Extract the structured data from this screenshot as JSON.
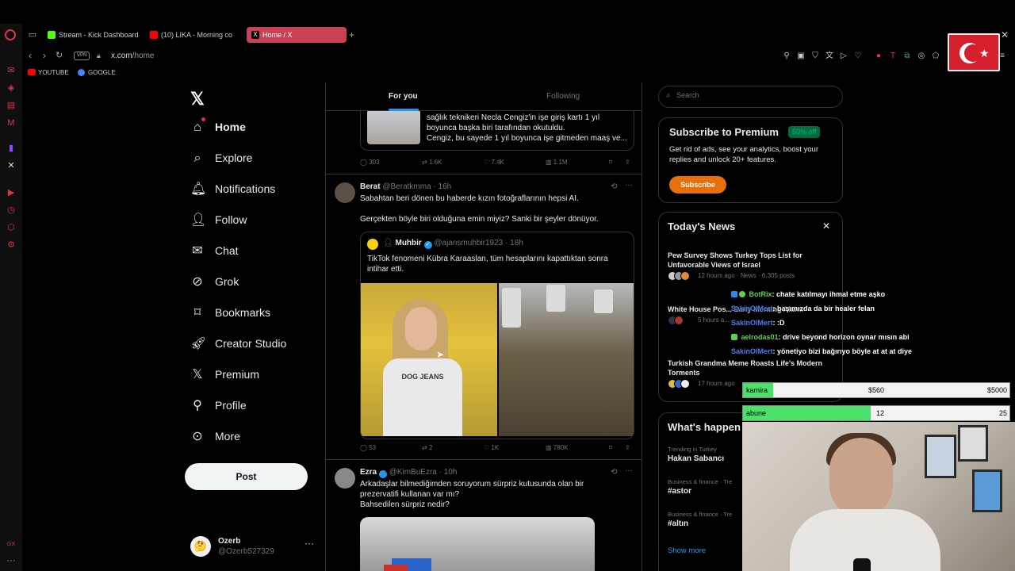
{
  "browser": {
    "tabs": [
      {
        "label": "Stream - Kick Dashboard",
        "color": "#53fc18"
      },
      {
        "label": "(10) LIKA - Morning co",
        "color": "#ff0000"
      },
      {
        "label": "Home / X",
        "color": "#000000"
      }
    ],
    "vpn": "VPN",
    "url_host": "x.com",
    "url_path": "/home",
    "bookmarks": [
      {
        "label": "YOUTUBE",
        "color": "#ff0000"
      },
      {
        "label": "GOOGLE",
        "color": "#4285f4"
      }
    ],
    "accent_color": "#c94152"
  },
  "nav": {
    "items": [
      {
        "label": "Home",
        "icon": "home-icon"
      },
      {
        "label": "Explore",
        "icon": "search-icon"
      },
      {
        "label": "Notifications",
        "icon": "bell-icon"
      },
      {
        "label": "Follow",
        "icon": "follow-icon"
      },
      {
        "label": "Chat",
        "icon": "mail-icon"
      },
      {
        "label": "Grok",
        "icon": "grok-icon"
      },
      {
        "label": "Bookmarks",
        "icon": "bookmark-icon"
      },
      {
        "label": "Creator Studio",
        "icon": "rocket-icon"
      },
      {
        "label": "Premium",
        "icon": "x-icon"
      },
      {
        "label": "Profile",
        "icon": "person-icon"
      },
      {
        "label": "More",
        "icon": "more-icon"
      }
    ],
    "post_label": "Post",
    "profile": {
      "name": "Ozerb",
      "handle": "@Ozerb527329"
    }
  },
  "feed": {
    "tabs": {
      "for_you": "For you",
      "following": "Following"
    },
    "top_tweet": {
      "text_lines": [
        "sağlık teknikeri Necla Cengiz'in işe giriş kartı 1 yıl",
        "boyunca başka biri tarafından okutuldu.",
        "Cengiz, bu sayede 1 yıl boyunca işe gitmeden maaş ve..."
      ],
      "replies": "303",
      "reposts": "1.6K",
      "likes": "7.4K",
      "views": "1.1M"
    },
    "tweet1": {
      "name": "Berat",
      "handle": "@Beratkmma",
      "time": "· 16h",
      "text1": "Sabahtan beri dönen bu haberde kızın fotoğraflarının hepsi AI.",
      "text2": "Gerçekten böyle biri olduğuna emin miyiz? Sanki bir şeyler dönüyor.",
      "quote": {
        "name": "Muhbir",
        "handle": "@ajansmuhbir1923",
        "time": "· 18h",
        "text": "TikTok fenomeni Kübra Karaaslan, tüm hesaplarını kapattıktan sonra intihar etti.",
        "shirt_text": "DOG JEANS"
      },
      "replies": "53",
      "reposts": "2",
      "likes": "1K",
      "views": "780K"
    },
    "tweet2": {
      "name": "Ezra",
      "handle": "@KimBuEzra",
      "time": "· 10h",
      "text_lines": [
        "Arkadaşlar bilmediğimden soruyorum sürpriz kutusunda olan bir",
        "prezervatifi kullanan var mı?",
        "Bahsedilen sürpriz nedir?"
      ]
    }
  },
  "sidebar": {
    "search_placeholder": "Search",
    "premium": {
      "title": "Subscribe to Premium",
      "badge": "50% off",
      "desc": "Get rid of ads, see your analytics, boost your replies and unlock 20+ features.",
      "button": "Subscribe"
    },
    "news": {
      "title": "Today's News",
      "items": [
        {
          "headline": "Pew Survey Shows Turkey Tops List for Unfavorable Views of Israel",
          "meta": "12 hours ago · News · 6,305 posts"
        },
        {
          "headline": "White House Pos... Early Morning Alarm",
          "meta": "5 hours a..."
        },
        {
          "headline": "Turkish Grandma Meme Roasts Life's Modern Torments",
          "meta": "17 hours ago"
        }
      ]
    },
    "happening": {
      "title": "What's happen",
      "trends": [
        {
          "context": "Trending in Turkey",
          "name": "Hakan Sabancı"
        },
        {
          "context": "Business & finance · Tre",
          "name": "#astor"
        },
        {
          "context": "Business & finance · Tre",
          "name": "#altın"
        }
      ],
      "show_more": "Show more"
    }
  },
  "stream": {
    "chat": [
      {
        "user": "BotRix",
        "msg": ": chate katılmayı ihmal etme aşko",
        "color": "#5ad14f"
      },
      {
        "user": "SakinOlMert",
        "msg": ": başımızda da bir healer felan",
        "color": "#4a7df0"
      },
      {
        "user": "SakinOlMert",
        "msg": ": :D",
        "color": "#4a7df0"
      },
      {
        "user": "aelrodas01",
        "msg": ": drive beyond horizon oynar mısın abi",
        "color": "#5ad14f"
      },
      {
        "user": "SakinOlMert",
        "msg": ": yönetiyo bizi bağırıyo böyle at at at diye",
        "color": "#4a7df0"
      }
    ],
    "goals": [
      {
        "label": "kamira",
        "current": "$560",
        "target": "$5000",
        "fraction": 0.112
      },
      {
        "label": "abune",
        "current": "12",
        "target": "25",
        "fraction": 0.48
      }
    ]
  }
}
